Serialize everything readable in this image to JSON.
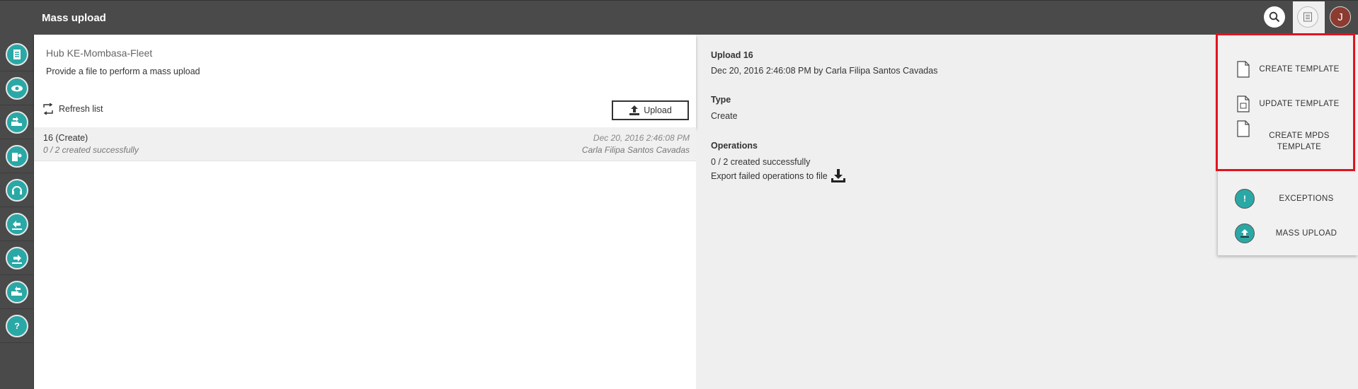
{
  "app": {
    "title": "Mass upload"
  },
  "topbar": {
    "search_icon": "search-icon",
    "doc_icon": "document-list-icon",
    "avatar_letter": "J"
  },
  "sidebar": {
    "items": [
      {
        "icon": "list-icon"
      },
      {
        "icon": "eye-icon"
      },
      {
        "icon": "truck-in-icon"
      },
      {
        "icon": "map-pin-icon"
      },
      {
        "icon": "headset-icon"
      },
      {
        "icon": "arrow-left-icon"
      },
      {
        "icon": "arrow-right-icon"
      },
      {
        "icon": "truck-out-icon"
      },
      {
        "icon": "help-icon"
      }
    ]
  },
  "hub": {
    "title": "Hub KE-Mombasa-Fleet",
    "description": "Provide a file to perform a mass upload",
    "refresh_label": "Refresh list",
    "upload_label": "Upload"
  },
  "list": {
    "rows": [
      {
        "title": "16 (Create)",
        "status": "0 / 2 created successfully",
        "date": "Dec 20, 2016 2:46:08 PM",
        "user": "Carla Filipa Santos Cavadas"
      }
    ]
  },
  "detail": {
    "title": "Upload 16",
    "meta": "Dec 20, 2016 2:46:08 PM by Carla Filipa Santos Cavadas",
    "type_label": "Type",
    "type_value": "Create",
    "operations_label": "Operations",
    "operations_value": "0 / 2 created successfully",
    "export_label": "Export failed operations to file"
  },
  "dropdown": {
    "items": [
      {
        "label": "CREATE TEMPLATE",
        "icon": "file-icon"
      },
      {
        "label": "UPDATE TEMPLATE",
        "icon": "file-refresh-icon"
      },
      {
        "label": "CREATE MPDS TEMPLATE",
        "icon": "file-icon"
      },
      {
        "label": "EXCEPTIONS",
        "icon": "exclamation-icon"
      },
      {
        "label": "MASS UPLOAD",
        "icon": "upload-icon"
      }
    ]
  },
  "colors": {
    "accent": "#2aa8a6",
    "topbar": "#4a4a4a",
    "highlight": "#e0141e"
  }
}
